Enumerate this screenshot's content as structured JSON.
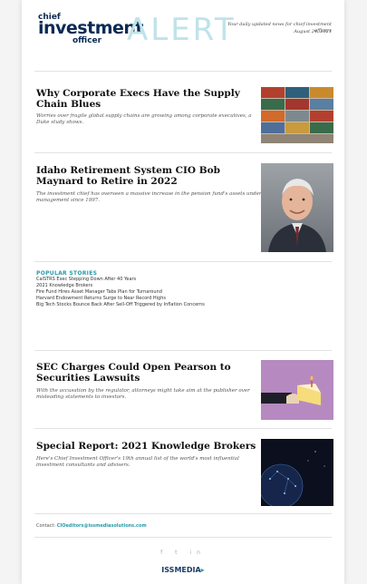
{
  "header": {
    "logo_top": "chief",
    "logo_main": "investment",
    "logo_bottom": "officer",
    "alert": "ALERT",
    "tagline": "Your daily updated news for chief investment officers",
    "date": "August 24, 2021"
  },
  "articles": [
    {
      "title": "Why Corporate Execs Have the Supply Chain Blues",
      "subtitle": "Worries over fragile global supply chains are growing among corporate executives, a Duke study shows."
    },
    {
      "title": "Idaho Retirement System CIO Bob Maynard to Retire in 2022",
      "subtitle": "The investment chief has overseen a massive increase in the pension fund's assets under management since 1997."
    },
    {
      "title": "SEC Charges Could Open Pearson to Securities Lawsuits",
      "subtitle": "With the accusation by the regulator, attorneys might take aim at the publisher over misleading statements to investors."
    },
    {
      "title": "Special Report: 2021 Knowledge Brokers",
      "subtitle": "Here's Chief Investment Officer's 19th annual list of the world's most influential investment consultants and advisers."
    }
  ],
  "popular": {
    "heading": "POPULAR STORIES",
    "items": [
      "CalSTRS Exec Stepping Down After 40 Years",
      "2021 Knowledge Brokers",
      "Fire Fund Hires Asset Manager Tabs Plan for Turnaround",
      "Harvard Endowment Returns Surge to Near Record Highs",
      "Big Tech Stocks Bounce Back After Sell-Off Triggered by Inflation Concerns"
    ]
  },
  "footer": {
    "contact_label": "Contact",
    "email": "CIOeditors@issmediasolutions.com",
    "social": "f  t  in",
    "brand": "ISSMEDIA"
  }
}
